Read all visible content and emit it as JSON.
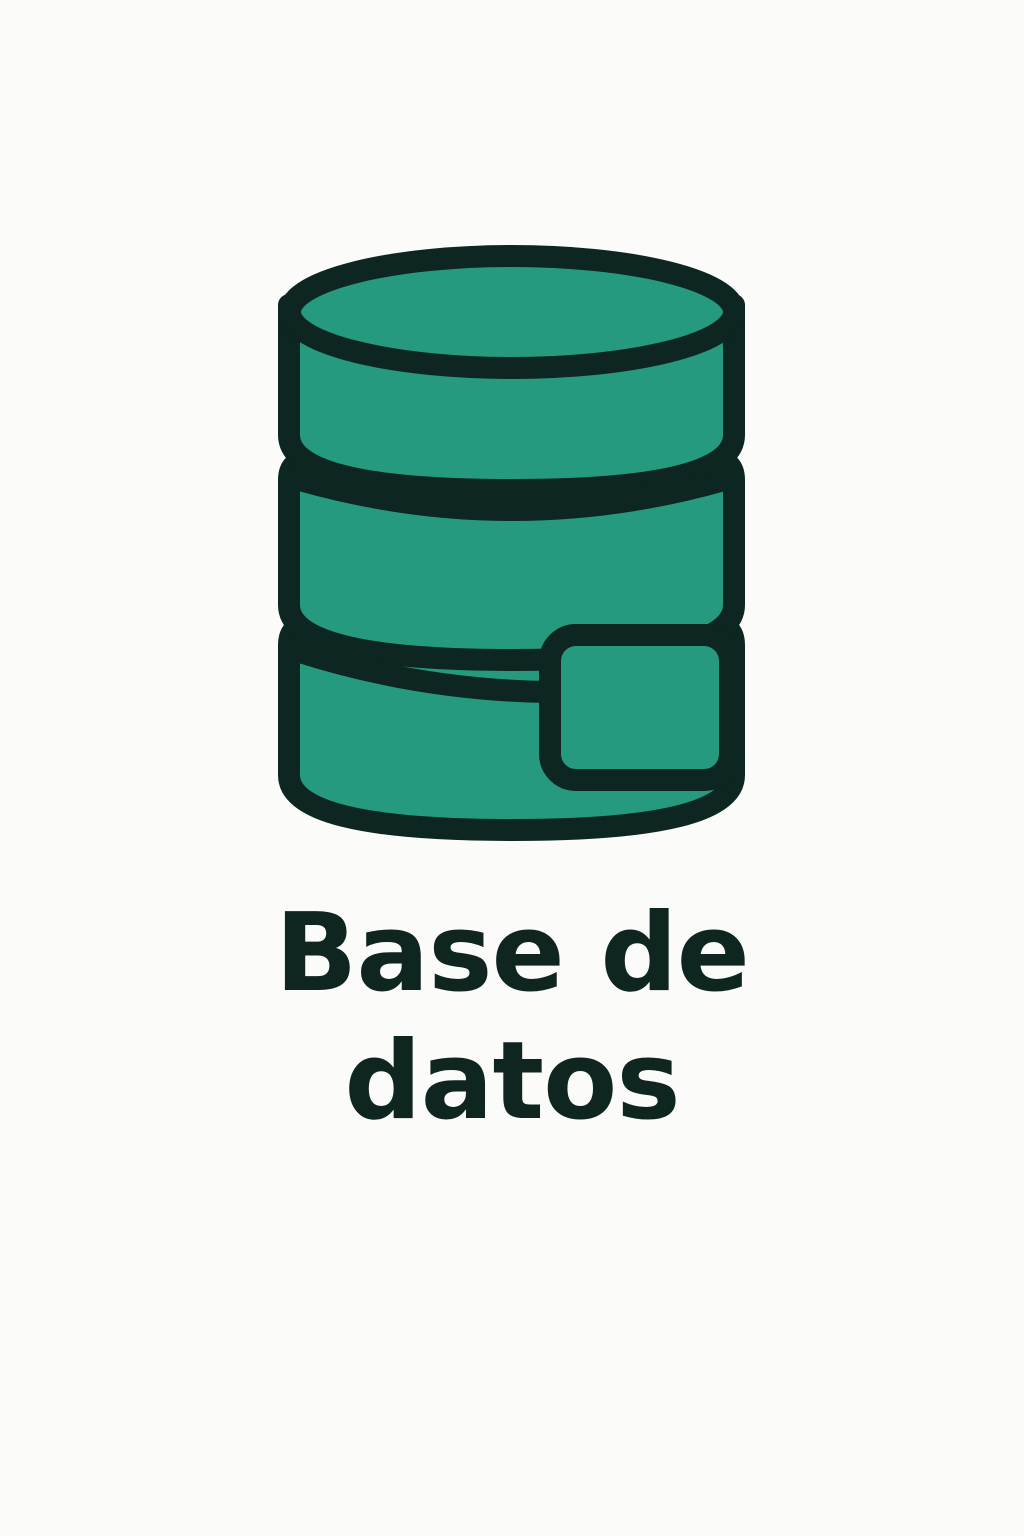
{
  "icon": {
    "name": "database-icon",
    "fill_color": "#269a7f",
    "stroke_color": "#0d2621"
  },
  "title": {
    "line1": "Base de",
    "line2": "datos"
  },
  "background_color": "#fbfbf9"
}
